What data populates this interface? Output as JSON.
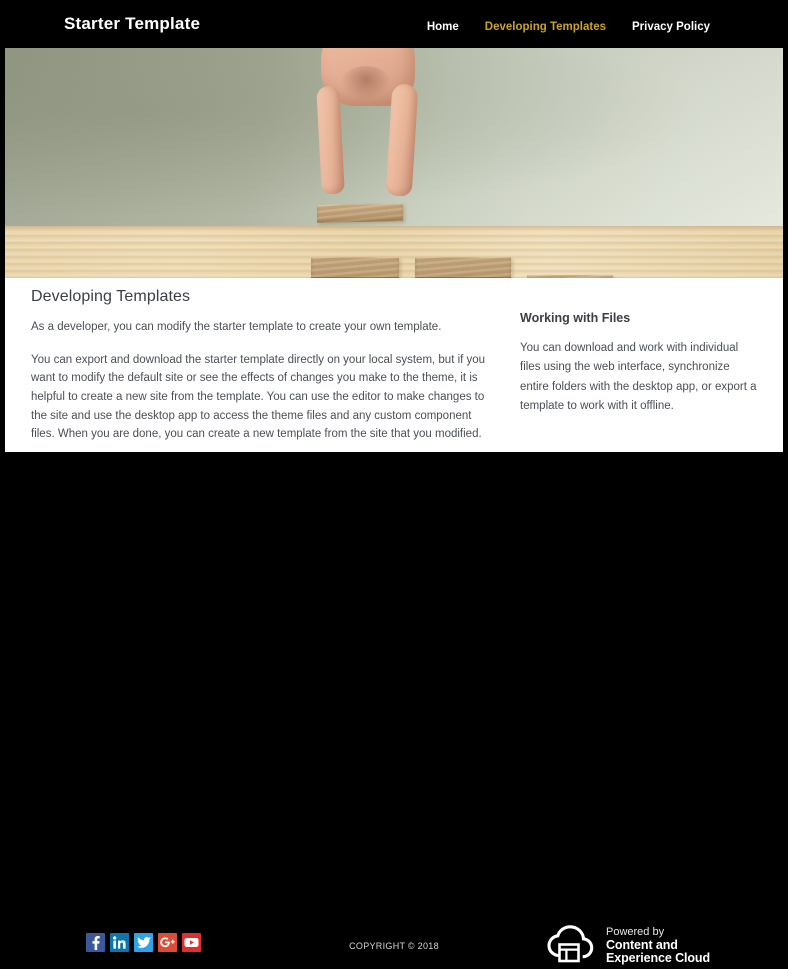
{
  "header": {
    "brand": "Starter Template",
    "nav": [
      {
        "label": "Home",
        "active": false
      },
      {
        "label": "Developing Templates",
        "active": true
      },
      {
        "label": "Privacy Policy",
        "active": false
      }
    ],
    "active_color": "#c9a227",
    "background": "#000000"
  },
  "hero": {
    "alt": "A hand placing a wooden block on a descending staircase of wooden blocks",
    "wall_color": "#9fa491",
    "table_color": "#e6d0a2",
    "block_color": "#bb9c71",
    "block_stacks": [
      3,
      3,
      2,
      1
    ]
  },
  "main": {
    "title": "Developing Templates",
    "paragraphs": [
      "As a developer, you can modify the starter template to create your own template.",
      "You can export and download the starter template directly on your local system, but if you want to modify the default site or see the effects of changes you make to the theme, it is helpful to create a new site from the template. You can use the editor to make changes to the site and use the desktop app to access the theme files and any custom component files. When you are done, you can create a new template from the site that you modified."
    ]
  },
  "aside": {
    "title": "Working with Files",
    "text": "You can download and work with individual files using the web interface, synchronize entire folders with the desktop app, or export a template to work with it offline."
  },
  "footer": {
    "copyright": "COPYRIGHT © 2018",
    "social": [
      {
        "name": "facebook",
        "glyph": "f",
        "color": "#3b5998"
      },
      {
        "name": "linkedin",
        "glyph": "in",
        "color": "#0e76a8"
      },
      {
        "name": "twitter",
        "glyph": "✈",
        "color": "#2fa3e8"
      },
      {
        "name": "googleplus",
        "glyph": "G+",
        "color": "#dd4b39"
      },
      {
        "name": "youtube",
        "glyph": "▶",
        "color": "#e02f2f"
      }
    ],
    "powered_by": {
      "line1": "Powered by",
      "line2": "Content and",
      "line3": "Experience Cloud"
    }
  }
}
